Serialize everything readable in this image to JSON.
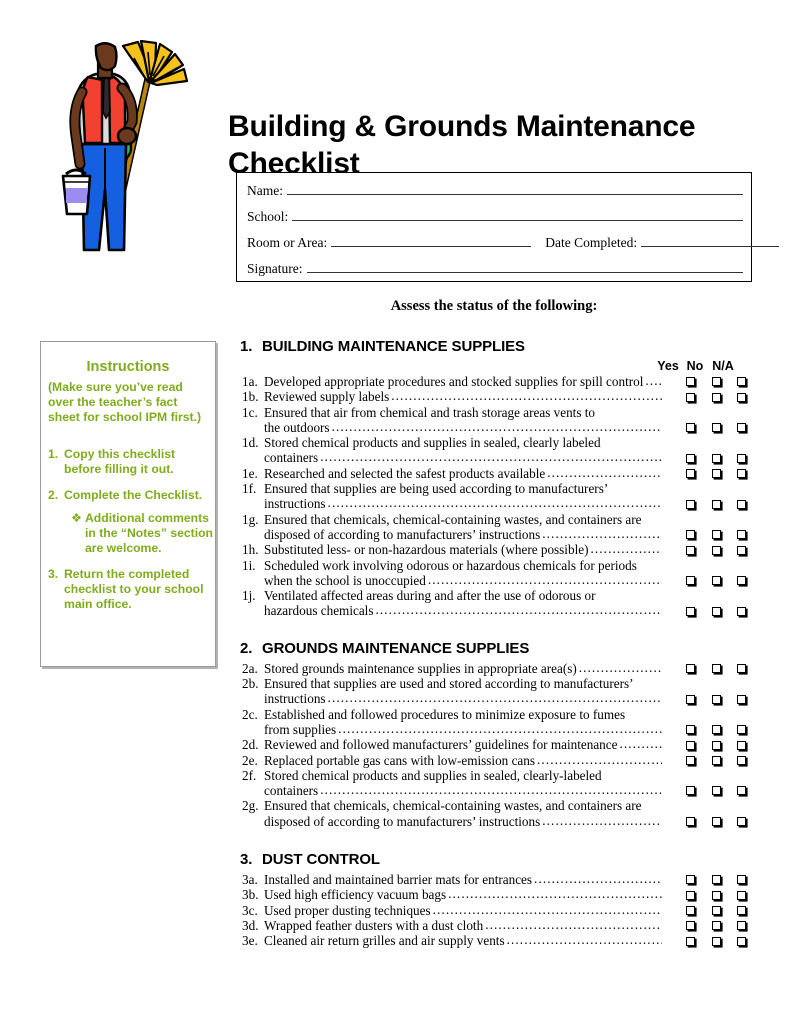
{
  "document": {
    "title": "Building & Grounds Maintenance Checklist",
    "assess_line": "Assess the status of the following:"
  },
  "illustration": {
    "name": "maintenance-worker-clipart",
    "description": "Custodial worker holding a broom and a bucket",
    "colors": {
      "skin": "#6B3A1E",
      "vest": "#F24130",
      "shirt": "#D9D9D9",
      "pants": "#1560E0",
      "broom_bristles": "#F5C21B",
      "broom_handle": "#B8860B",
      "green_item": "#1FC24A",
      "bucket_band": "#9B8CF0",
      "outline": "#000000"
    }
  },
  "id_box": {
    "rows": [
      {
        "label": "Name:"
      },
      {
        "label": "School:"
      },
      {
        "label": "Room or Area:",
        "label2": "Date Completed:"
      },
      {
        "label": "Signature:"
      }
    ]
  },
  "instructions": {
    "heading": "Instructions",
    "note": "(Make sure you’ve read over the teacher’s fact sheet for school IPM first.)",
    "accent_color": "#7FAC1C",
    "steps": [
      {
        "num": "1.",
        "text": "Copy this checklist before filling it out."
      },
      {
        "num": "2.",
        "text": "Complete the Checklist."
      },
      {
        "num": "3.",
        "text": "Return the completed checklist to your school main office."
      }
    ],
    "substep": {
      "bullet": "❖",
      "text": "Additional comments in the “Notes” section are welcome."
    }
  },
  "columns": {
    "yes": "Yes",
    "no": "No",
    "na": "N/A"
  },
  "sections": [
    {
      "number": "1.",
      "title": "BUILDING MAINTENANCE SUPPLIES",
      "items": [
        {
          "label": "1a.",
          "lines": [
            "Developed appropriate procedures and stocked supplies for spill control"
          ],
          "leader_line": 0
        },
        {
          "label": "1b.",
          "lines": [
            "Reviewed supply labels"
          ],
          "leader_line": 0
        },
        {
          "label": "1c.",
          "lines": [
            "Ensured that air from chemical and trash storage areas vents to",
            "the outdoors"
          ],
          "leader_line": 1
        },
        {
          "label": "1d.",
          "lines": [
            "Stored chemical products and supplies in sealed, clearly labeled",
            "containers"
          ],
          "leader_line": 1
        },
        {
          "label": "1e.",
          "lines": [
            "Researched and selected the safest products available"
          ],
          "leader_line": 0
        },
        {
          "label": "1f.",
          "lines": [
            "Ensured that supplies are being used according to manufacturers’",
            "instructions"
          ],
          "leader_line": 1
        },
        {
          "label": "1g.",
          "lines": [
            "Ensured that chemicals, chemical-containing wastes, and containers are",
            "disposed of according to manufacturers’ instructions"
          ],
          "leader_line": 1
        },
        {
          "label": "1h.",
          "lines": [
            "Substituted less- or non-hazardous materials (where possible)"
          ],
          "leader_line": 0
        },
        {
          "label": "1i.",
          "lines": [
            "Scheduled work involving odorous or hazardous chemicals for periods",
            "when the school is unoccupied"
          ],
          "leader_line": 1
        },
        {
          "label": "1j.",
          "lines": [
            "Ventilated affected areas during and after the use of odorous or",
            "hazardous chemicals"
          ],
          "leader_line": 1
        }
      ]
    },
    {
      "number": "2.",
      "title": "GROUNDS MAINTENANCE SUPPLIES",
      "items": [
        {
          "label": "2a.",
          "lines": [
            "Stored grounds maintenance supplies in appropriate area(s)"
          ],
          "leader_line": 0
        },
        {
          "label": "2b.",
          "lines": [
            "Ensured that supplies are used and stored according to manufacturers’",
            "instructions"
          ],
          "leader_line": 1
        },
        {
          "label": "2c.",
          "lines": [
            "Established and followed procedures to minimize exposure to fumes",
            "from supplies"
          ],
          "leader_line": 1
        },
        {
          "label": "2d.",
          "lines": [
            "Reviewed and followed manufacturers’ guidelines for maintenance"
          ],
          "leader_line": 0
        },
        {
          "label": "2e.",
          "lines": [
            "Replaced portable gas cans with low-emission cans"
          ],
          "leader_line": 0
        },
        {
          "label": "2f.",
          "lines": [
            "Stored chemical products and supplies in sealed, clearly-labeled",
            "containers"
          ],
          "leader_line": 1
        },
        {
          "label": "2g.",
          "lines": [
            "Ensured that chemicals, chemical-containing wastes, and containers are",
            "disposed of according to manufacturers’ instructions"
          ],
          "leader_line": 1
        }
      ]
    },
    {
      "number": "3.",
      "title": "DUST CONTROL",
      "items": [
        {
          "label": "3a.",
          "lines": [
            "Installed and maintained barrier mats for entrances"
          ],
          "leader_line": 0
        },
        {
          "label": "3b.",
          "lines": [
            "Used high efficiency vacuum bags"
          ],
          "leader_line": 0
        },
        {
          "label": "3c.",
          "lines": [
            "Used proper dusting techniques"
          ],
          "leader_line": 0
        },
        {
          "label": "3d.",
          "lines": [
            "Wrapped feather dusters with a dust cloth"
          ],
          "leader_line": 0
        },
        {
          "label": "3e.",
          "lines": [
            "Cleaned air return grilles and air supply vents"
          ],
          "leader_line": 0
        }
      ]
    }
  ]
}
